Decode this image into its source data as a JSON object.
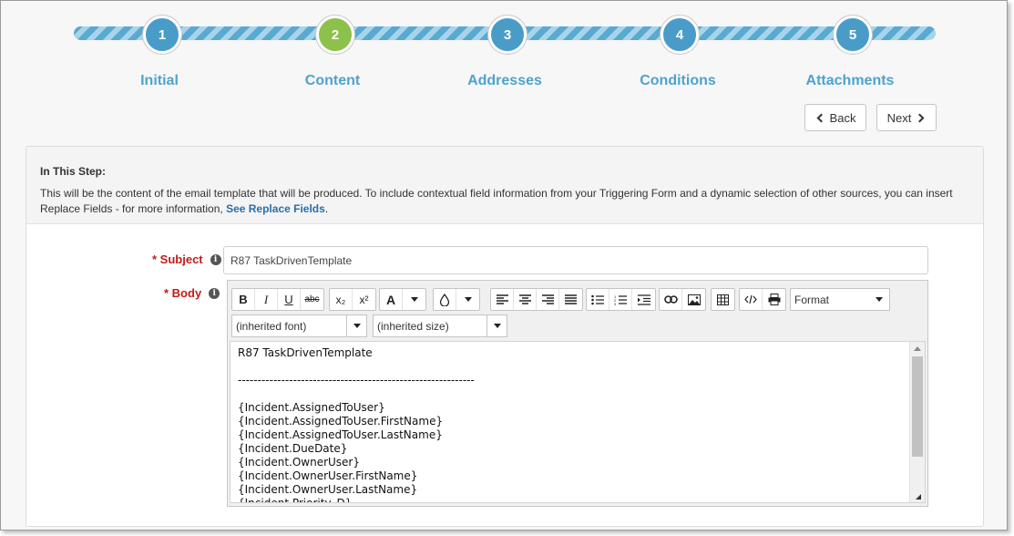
{
  "wizard": {
    "steps": [
      {
        "number": "1",
        "label": "Initial"
      },
      {
        "number": "2",
        "label": "Content"
      },
      {
        "number": "3",
        "label": "Addresses"
      },
      {
        "number": "4",
        "label": "Conditions"
      },
      {
        "number": "5",
        "label": "Attachments"
      }
    ],
    "active_step": "2",
    "back_label": "Back",
    "next_label": "Next"
  },
  "info": {
    "heading": "In This Step:",
    "text": "This will be the content of the email template that will be produced. To include contextual field information from your Triggering Form and a dynamic selection of other sources, you can insert Replace Fields - for more information, ",
    "link": "See Replace Fields",
    "trailing": "."
  },
  "form": {
    "subject_label": "* Subject",
    "subject_value": "R87 TaskDrivenTemplate",
    "body_label": "* Body"
  },
  "toolbar": {
    "bold": "B",
    "italic": "I",
    "underline": "U",
    "strike": "abc",
    "subscript": "x₂",
    "superscript": "x²",
    "font_color": "A",
    "format_label": "Format",
    "font_value": "(inherited font)",
    "size_value": "(inherited size)"
  },
  "body_lines": [
    "R87 TaskDrivenTemplate",
    "",
    "------------------------------------------------------------",
    "",
    "{Incident.AssignedToUser}",
    "{Incident.AssignedToUser.FirstName}",
    "{Incident.AssignedToUser.LastName}",
    "{Incident.DueDate}",
    "{Incident.OwnerUser}",
    "{Incident.OwnerUser.FirstName}",
    "{Incident.OwnerUser.LastName}",
    "{Incident.Priority_D}"
  ],
  "colors": {
    "step_blue": "#4a9cc8",
    "step_active": "#8cc14c",
    "label_blue": "#4da3cd",
    "required_red": "#c41a1a",
    "link_blue": "#2a6ea8"
  }
}
